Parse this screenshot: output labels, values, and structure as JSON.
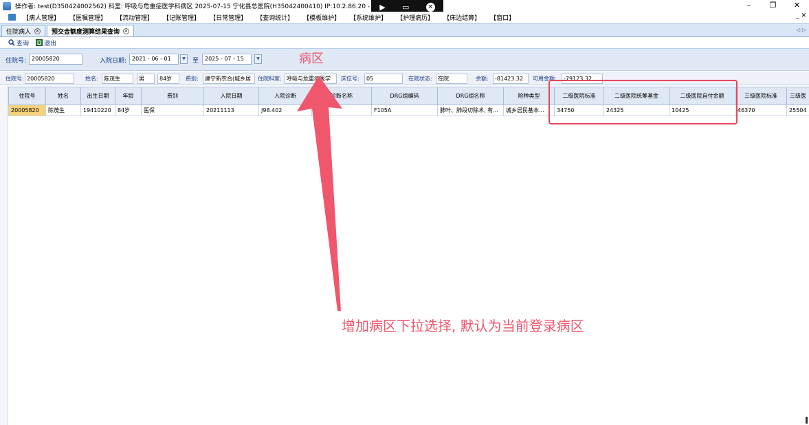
{
  "titlebar": {
    "title": "操作者: test(D350424002562)  科室: 呼吸与危重症医学科病区  2025-07-15  宁化县总医院(H35042400410) IP:10.2.86.20 - [公共",
    "minimize": "–",
    "restore": "❐",
    "close": "✕"
  },
  "remote_bar": {
    "pin": "▶",
    "screen": "▭",
    "close": "✕"
  },
  "menu": {
    "items": [
      "【病人管理】",
      "【医嘱管理】",
      "【流动管理】",
      "【记账管理】",
      "【日常管理】",
      "【查询统计】",
      "【模板维护】",
      "【系统维护】",
      "【护理病历】",
      "【床边结算】",
      "【窗口】"
    ],
    "mdi_close": "_ ✕"
  },
  "tabs": [
    {
      "label": "住院病人",
      "active": false
    },
    {
      "label": "预交金额度测算结果查询",
      "active": true
    }
  ],
  "tab_nav": "◁ ▷",
  "toolbar": {
    "query_label": "查询",
    "exit_label": "退出"
  },
  "filter": {
    "inpatient_no_label": "住院号:",
    "inpatient_no_value": "20005820",
    "admit_date_label": "入院日期:",
    "date_from": "2021 - 06 - 01",
    "to_label": "至",
    "date_to": "2025 - 07 - 15"
  },
  "info": {
    "inpatient_no_label": "住院号:",
    "inpatient_no": "20005820",
    "name_label": "姓名:",
    "name": "陈茂生",
    "sex": "男",
    "age": "84岁",
    "fee_type_label": "费别:",
    "fee_type": "建宁新农合(城乡居",
    "dept_label": "住院科室:",
    "dept": "呼吸与危重症医学",
    "bed_label": "床位号:",
    "bed": "05",
    "status_label": "在院状态:",
    "status": "在院",
    "balance_label": "余额:",
    "balance": "-81423.32",
    "available_label": "可用金额:",
    "available": "-79123.32"
  },
  "table": {
    "columns": [
      "住院号",
      "姓名",
      "出生日期",
      "年龄",
      "费别",
      "入院日期",
      "入院诊断",
      "诊断名称",
      "DRG组编码",
      "DRG组名称",
      "险种类型",
      "二级医院标准",
      "二级医院统筹基金",
      "二级医院自付金额",
      "三级医院标准",
      "三级医"
    ],
    "rows": [
      [
        "20005820",
        "陈茂生",
        "19410220",
        "84岁",
        "医保",
        "20211113",
        "J98.402",
        "",
        "F105A",
        "肺叶、肺段切除术, 有...",
        "城乡居民基本...",
        "34750",
        "24325",
        "10425",
        "46370",
        "25504"
      ]
    ]
  },
  "annotations": {
    "top_label": "病区",
    "bottom_text": "增加病区下拉选择, 默认为当前登录病区",
    "color": "#f0566c"
  }
}
